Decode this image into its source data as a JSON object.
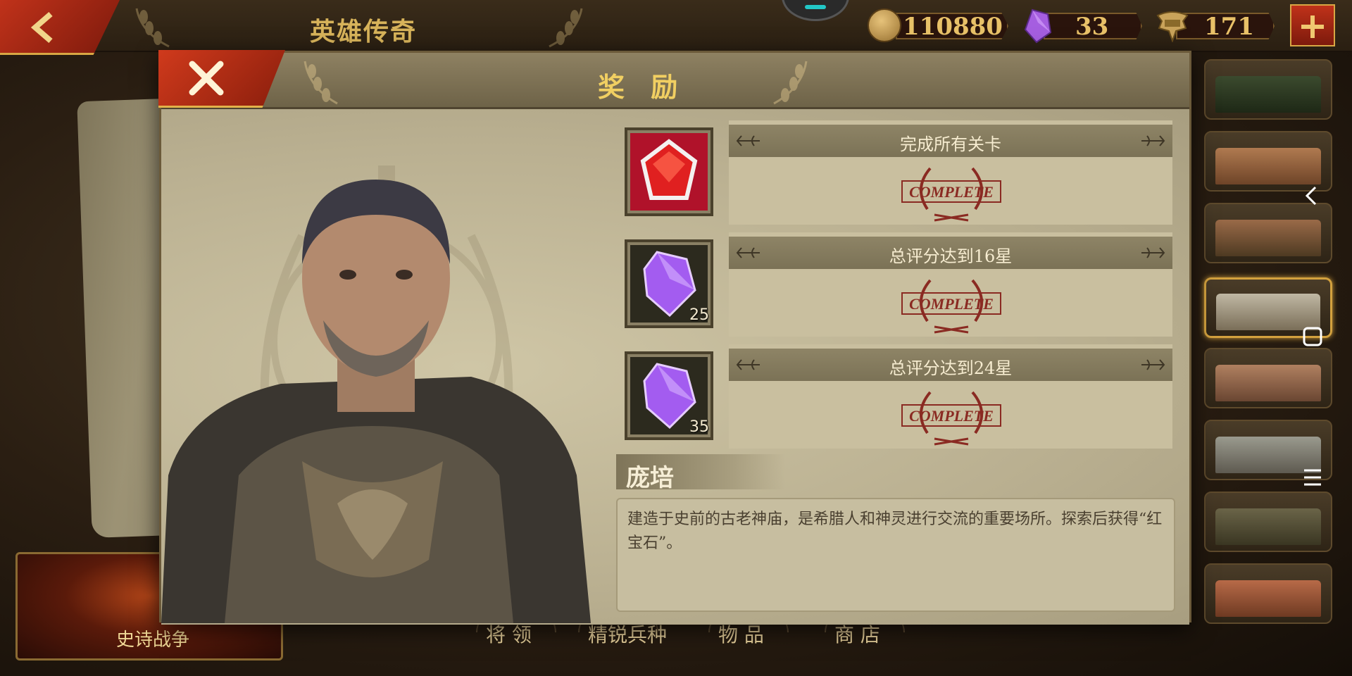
{
  "header": {
    "title": "英雄传奇",
    "resources": {
      "gold": "110880",
      "gems": "33",
      "honor": "171"
    }
  },
  "modal": {
    "title": "奖 励",
    "rewards": [
      {
        "label": "完成所有关卡",
        "status": "COMPLETE",
        "icon": "ruby-icon",
        "count": ""
      },
      {
        "label": "总评分达到16星",
        "status": "COMPLETE",
        "icon": "amethyst-icon",
        "count": "25"
      },
      {
        "label": "总评分达到24星",
        "status": "COMPLETE",
        "icon": "amethyst-icon",
        "count": "35"
      }
    ],
    "hero_name": "庞培",
    "description": "建造于史前的古老神庙，是希腊人和神灵进行交流的重要场所。探索后获得“红宝石”。"
  },
  "bottom": {
    "epic_war": "史诗战争",
    "nav": [
      "将 领",
      "精锐兵种",
      "物 品",
      "商 店"
    ]
  },
  "colors": {
    "accent_red": "#c0321a",
    "gold_text": "#f1cf62",
    "parchment": "#bdb394"
  }
}
